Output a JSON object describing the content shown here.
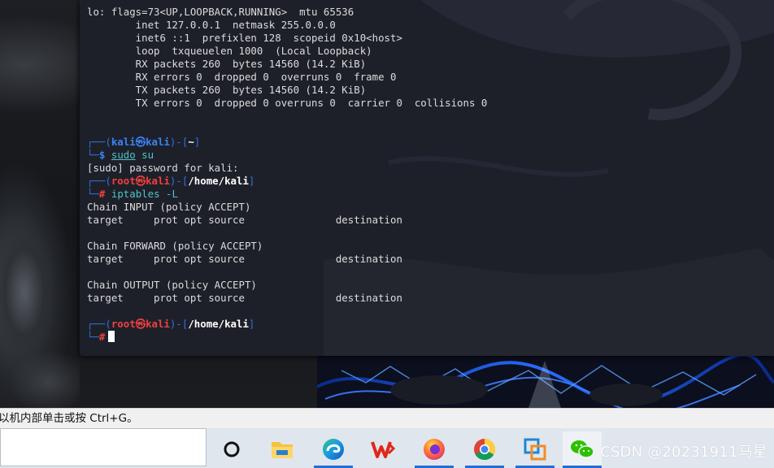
{
  "terminal": {
    "ifconfig": [
      "lo: flags=73<UP,LOOPBACK,RUNNING>  mtu 65536",
      "        inet 127.0.0.1  netmask 255.0.0.0",
      "        inet6 ::1  prefixlen 128  scopeid 0x10<host>",
      "        loop  txqueuelen 1000  (Local Loopback)",
      "        RX packets 260  bytes 14560 (14.2 KiB)",
      "        RX errors 0  dropped 0  overruns 0  frame 0",
      "        TX packets 260  bytes 14560 (14.2 KiB)",
      "        TX errors 0  dropped 0 overruns 0  carrier 0  collisions 0"
    ],
    "prompt1": {
      "user": "kali",
      "at": "㉿",
      "host": "kali",
      "dir": "~",
      "symbol": "$",
      "command_sudo": "sudo",
      "command_rest": " su"
    },
    "sudo_password_line": "[sudo] password for kali:",
    "prompt2": {
      "user": "root",
      "at": "㉿",
      "host": "kali",
      "dir": "/home/kali",
      "symbol": "#",
      "command": "iptables -L"
    },
    "iptables_output": [
      "Chain INPUT (policy ACCEPT)",
      "target     prot opt source               destination",
      "",
      "Chain FORWARD (policy ACCEPT)",
      "target     prot opt source               destination",
      "",
      "Chain OUTPUT (policy ACCEPT)",
      "target     prot opt source               destination"
    ],
    "prompt3": {
      "user": "root",
      "at": "㉿",
      "host": "kali",
      "dir": "/home/kali",
      "symbol": "#"
    }
  },
  "hint_bar": {
    "text": "以机内部单击或按 Ctrl+G。"
  },
  "taskbar": {
    "icons": [
      "cortana-icon",
      "file-explorer-icon",
      "edge-icon",
      "wps-icon",
      "firefox-icon",
      "chrome-icon",
      "vmware-icon",
      "wechat-icon"
    ],
    "watermark": "CSDN @20231911马星"
  },
  "colors": {
    "terminal_bg": "#1e2029",
    "prompt_blue": "#2f6fe0",
    "prompt_red": "#e63a3a",
    "command_cyan": "#4fc3c8",
    "taskbar_bg": "#dfe6ee"
  }
}
